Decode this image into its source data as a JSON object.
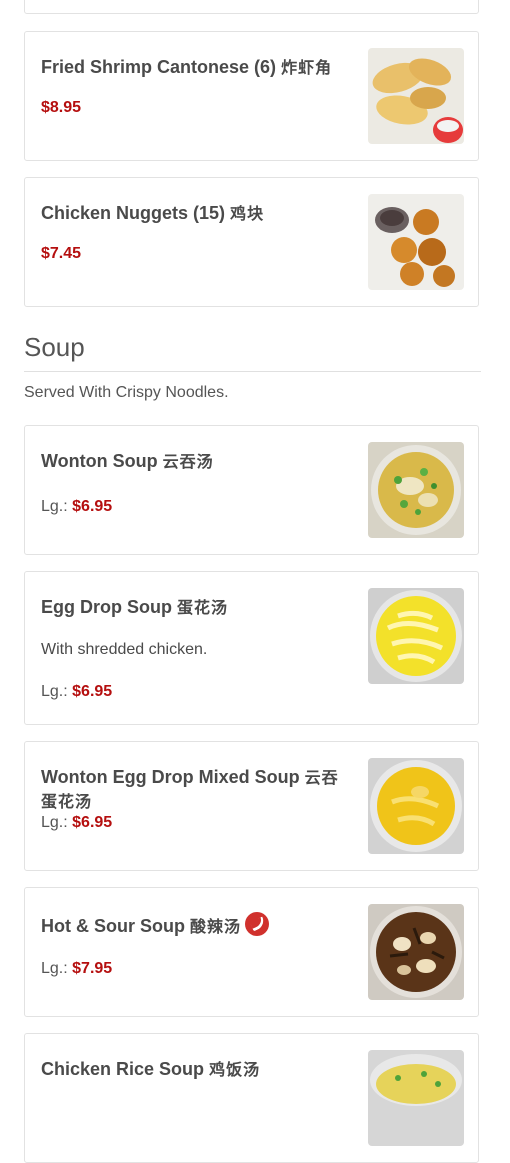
{
  "items_top": [
    {
      "name": "Fried Shrimp Cantonese (6)",
      "chinese": "炸虾角",
      "price": "$8.95"
    },
    {
      "name": "Chicken Nuggets (15)",
      "chinese": "鸡块",
      "price": "$7.45"
    }
  ],
  "soup_section": {
    "title": "Soup",
    "description": "Served With Crispy Noodles.",
    "items": [
      {
        "name": "Wonton Soup",
        "chinese": "云吞汤",
        "size_label": "Lg.:",
        "price": "$6.95"
      },
      {
        "name": "Egg Drop Soup",
        "chinese": "蛋花汤",
        "description": "With shredded chicken.",
        "size_label": "Lg.:",
        "price": "$6.95"
      },
      {
        "name": "Wonton Egg Drop Mixed Soup",
        "chinese": "云吞蛋花汤",
        "size_label": "Lg.:",
        "price": "$6.95"
      },
      {
        "name": "Hot & Sour Soup",
        "chinese": "酸辣汤",
        "size_label": "Lg.:",
        "price": "$7.95",
        "spicy": "chili-pepper-icon"
      },
      {
        "name": "Chicken Rice Soup",
        "chinese": "鸡饭汤"
      }
    ]
  },
  "colors": {
    "price": "#b50f0f",
    "border": "#e2e2e2",
    "spicy": "#d0312d"
  }
}
